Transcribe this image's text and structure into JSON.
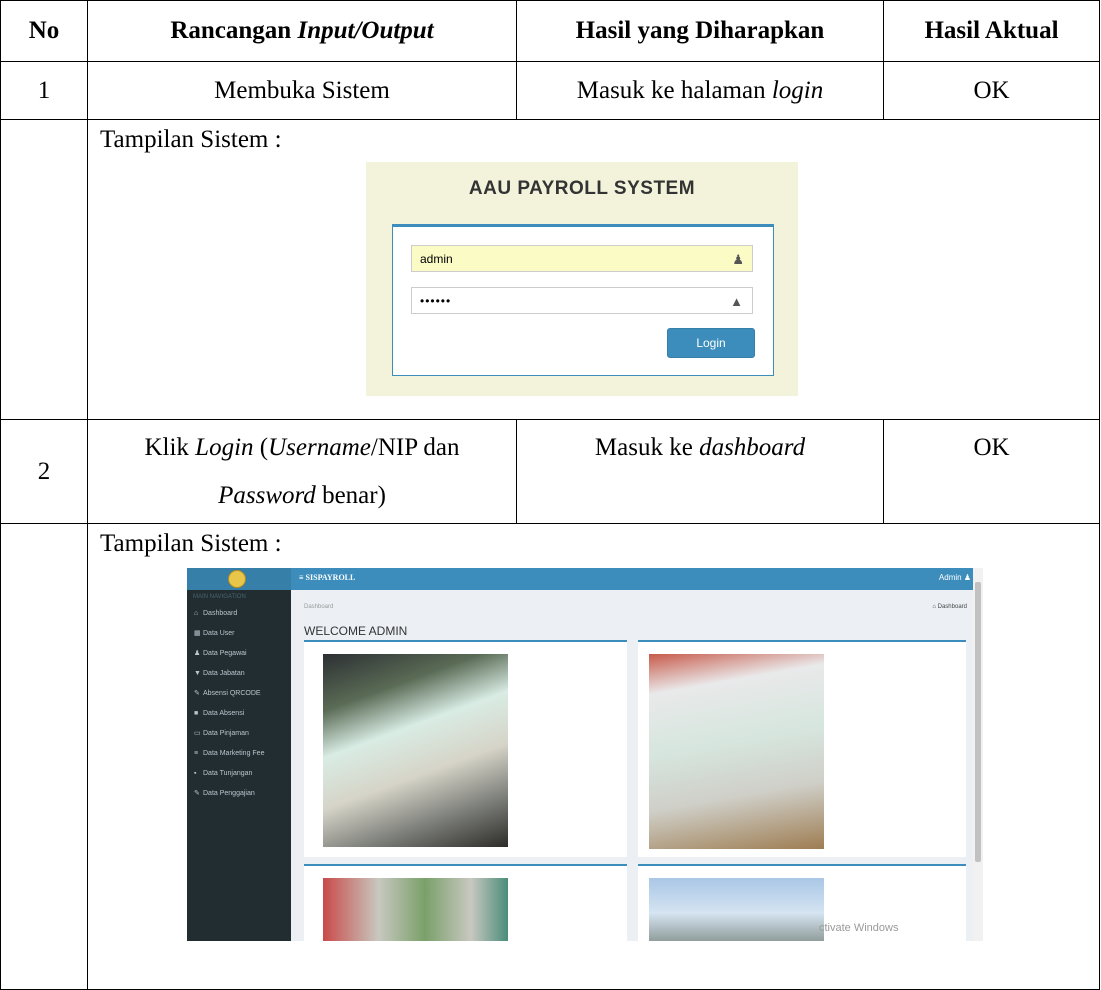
{
  "headers": {
    "no": "No",
    "rancangan_prefix": "Rancangan ",
    "rancangan_italic": "Input/Output",
    "diharapkan": "Hasil yang Diharapkan",
    "aktual": "Hasil Aktual"
  },
  "row1": {
    "no": "1",
    "input": "Membuka Sistem",
    "expected_prefix": "Masuk ke halaman ",
    "expected_italic": "login",
    "actual": "OK"
  },
  "screen1": {
    "label": "Tampilan Sistem :",
    "title": "AAU PAYROLL SYSTEM",
    "username": "admin",
    "password": "••••••",
    "login_button": "Login"
  },
  "row2": {
    "no": "2",
    "input_p1": "Klik ",
    "input_login": "Login",
    "input_p2": " (",
    "input_username": "Username",
    "input_p3": "/NIP dan",
    "input_password": "Password",
    "input_p4": " benar)",
    "expected_prefix": "Masuk ke ",
    "expected_italic": "dashboard",
    "actual": "OK"
  },
  "screen2": {
    "label": "Tampilan Sistem :",
    "brand": "≡  SISPAYROLL",
    "admin": "Admin ♟",
    "nav_heading": "MAIN NAVIGATION",
    "menu": [
      {
        "icon": "⌂",
        "label": "Dashboard"
      },
      {
        "icon": "▦",
        "label": "Data User"
      },
      {
        "icon": "♟",
        "label": "Data Pegawai"
      },
      {
        "icon": "▼",
        "label": "Data Jabatan"
      },
      {
        "icon": "✎",
        "label": "Absensi QRCODE"
      },
      {
        "icon": "■",
        "label": "Data Absensi"
      },
      {
        "icon": "▭",
        "label": "Data Pinjaman"
      },
      {
        "icon": "≡",
        "label": "Data Marketing Fee"
      },
      {
        "icon": "▪",
        "label": "Data Tunjangan"
      },
      {
        "icon": "✎",
        "label": "Data Penggajian"
      }
    ],
    "breadcrumb": "Dashboard",
    "breadcrumb_right": "⌂ Dashboard",
    "welcome": "WELCOME ADMIN",
    "watermark": "ctivate Windows"
  },
  "colors": {
    "primary": "#3c8dbc",
    "sidebar": "#222d32",
    "login_bg": "#f3f3dc"
  }
}
